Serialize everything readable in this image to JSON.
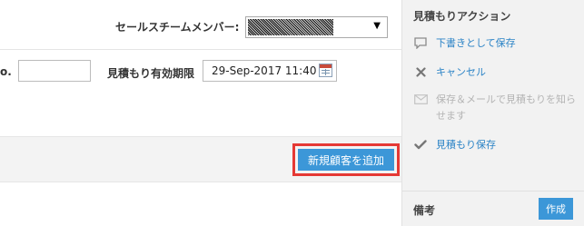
{
  "form": {
    "team_member_label": "セールスチームメンバー:",
    "team_member_value_masked": true,
    "quote_no_label": "o.",
    "quote_no_value": "",
    "expiry_label": "見積もり有効期限",
    "expiry_value": "29-Sep-2017 11:40",
    "add_customer_label": "新規顧客を追加"
  },
  "sidebar": {
    "title": "見積もりアクション",
    "actions": [
      {
        "label": "下書きとして保存",
        "icon": "comment-icon",
        "enabled": true
      },
      {
        "label": "キャンセル",
        "icon": "close-icon",
        "enabled": true
      },
      {
        "label": "保存＆メールで見積もりを知らせます",
        "icon": "envelope-icon",
        "enabled": false
      },
      {
        "label": "見積もり保存",
        "icon": "checkmark-icon",
        "enabled": true
      }
    ],
    "notes_label": "備考",
    "create_label": "作成"
  },
  "colors": {
    "accent": "#3c97d8",
    "link": "#2b83c6",
    "highlight": "#e53935",
    "disabled": "#b4b4b4"
  }
}
